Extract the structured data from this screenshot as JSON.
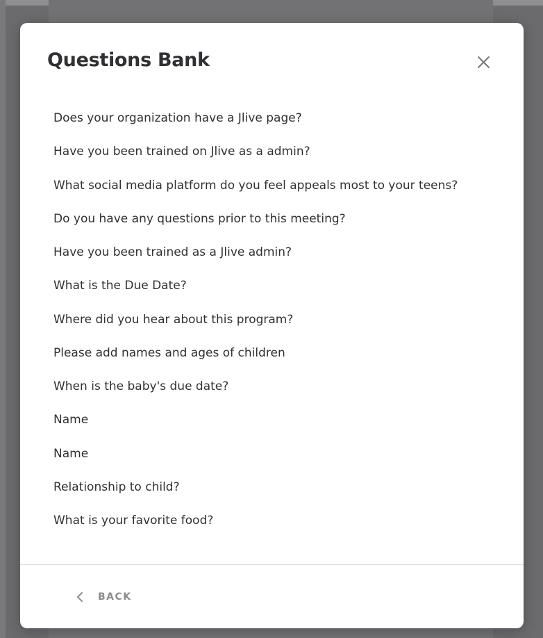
{
  "modal": {
    "title": "Questions Bank",
    "close_icon": "close-icon"
  },
  "questions": [
    "Does your organization have a Jlive page?",
    "Have you been trained on Jlive as a admin?",
    "What social media platform do you feel appeals most to your teens?",
    "Do you have any questions prior to this meeting?",
    "Have you been trained as a Jlive admin?",
    "What is the Due Date?",
    "Where did you hear about this program?",
    "Please add names and ages of children",
    "When is the baby's due date?",
    "Name",
    "Name",
    "Relationship to child?",
    "What is your favorite food?"
  ],
  "footer": {
    "back_label": "BACK",
    "back_icon": "chevron-left-icon"
  },
  "colors": {
    "backdrop": "#6b6b6d",
    "modal_bg": "#ffffff",
    "title": "#2e3033",
    "text": "#2f3133",
    "muted": "#8a8c8f",
    "divider": "#dcdcdc"
  }
}
